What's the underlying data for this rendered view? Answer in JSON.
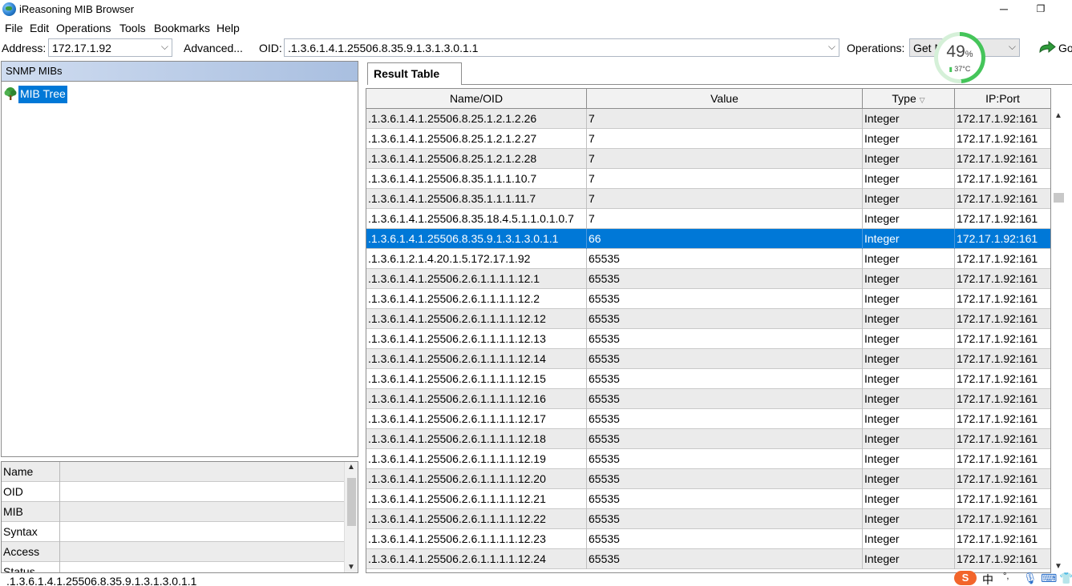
{
  "window": {
    "title": "iReasoning MIB Browser",
    "minimize_glyph": "─",
    "maximize_glyph": "❐"
  },
  "menu": [
    "File",
    "Edit",
    "Operations",
    "Tools",
    "Bookmarks",
    "Help"
  ],
  "toolbar": {
    "address_label": "Address:",
    "address_value": "172.17.1.92",
    "advanced_label": "Advanced...",
    "oid_label": "OID:",
    "oid_value": ".1.3.6.1.4.1.25506.8.35.9.1.3.1.3.0.1.1",
    "operations_label": "Operations:",
    "operations_value": "Get N",
    "go_label": "Go",
    "go_icon": "go-arrow-icon"
  },
  "cpu_widget": {
    "percent": "49",
    "percent_sign": "%",
    "temperature": "37°C",
    "load_fraction": 0.49,
    "ring_color": "#45c55a"
  },
  "mib_panel": {
    "header": "SNMP MIBs",
    "tree_root": "MIB Tree",
    "tree_icon": "tree-icon"
  },
  "properties": {
    "rows": [
      "Name",
      "OID",
      "MIB",
      "Syntax",
      "Access",
      "Status"
    ]
  },
  "result": {
    "tab_label": "Result Table",
    "columns": [
      "Name/OID",
      "Value",
      "Type",
      "IP:Port"
    ],
    "sort_indicator": "▽",
    "selected_row_index": 6,
    "rows": [
      [
        ".1.3.6.1.4.1.25506.8.25.1.2.1.2.26",
        "7",
        "Integer",
        "172.17.1.92:161"
      ],
      [
        ".1.3.6.1.4.1.25506.8.25.1.2.1.2.27",
        "7",
        "Integer",
        "172.17.1.92:161"
      ],
      [
        ".1.3.6.1.4.1.25506.8.25.1.2.1.2.28",
        "7",
        "Integer",
        "172.17.1.92:161"
      ],
      [
        ".1.3.6.1.4.1.25506.8.35.1.1.1.10.7",
        "7",
        "Integer",
        "172.17.1.92:161"
      ],
      [
        ".1.3.6.1.4.1.25506.8.35.1.1.1.11.7",
        "7",
        "Integer",
        "172.17.1.92:161"
      ],
      [
        ".1.3.6.1.4.1.25506.8.35.18.4.5.1.1.0.1.0.7",
        "7",
        "Integer",
        "172.17.1.92:161"
      ],
      [
        ".1.3.6.1.4.1.25506.8.35.9.1.3.1.3.0.1.1",
        "66",
        "Integer",
        "172.17.1.92:161"
      ],
      [
        ".1.3.6.1.2.1.4.20.1.5.172.17.1.92",
        "65535",
        "Integer",
        "172.17.1.92:161"
      ],
      [
        ".1.3.6.1.4.1.25506.2.6.1.1.1.1.12.1",
        "65535",
        "Integer",
        "172.17.1.92:161"
      ],
      [
        ".1.3.6.1.4.1.25506.2.6.1.1.1.1.12.2",
        "65535",
        "Integer",
        "172.17.1.92:161"
      ],
      [
        ".1.3.6.1.4.1.25506.2.6.1.1.1.1.12.12",
        "65535",
        "Integer",
        "172.17.1.92:161"
      ],
      [
        ".1.3.6.1.4.1.25506.2.6.1.1.1.1.12.13",
        "65535",
        "Integer",
        "172.17.1.92:161"
      ],
      [
        ".1.3.6.1.4.1.25506.2.6.1.1.1.1.12.14",
        "65535",
        "Integer",
        "172.17.1.92:161"
      ],
      [
        ".1.3.6.1.4.1.25506.2.6.1.1.1.1.12.15",
        "65535",
        "Integer",
        "172.17.1.92:161"
      ],
      [
        ".1.3.6.1.4.1.25506.2.6.1.1.1.1.12.16",
        "65535",
        "Integer",
        "172.17.1.92:161"
      ],
      [
        ".1.3.6.1.4.1.25506.2.6.1.1.1.1.12.17",
        "65535",
        "Integer",
        "172.17.1.92:161"
      ],
      [
        ".1.3.6.1.4.1.25506.2.6.1.1.1.1.12.18",
        "65535",
        "Integer",
        "172.17.1.92:161"
      ],
      [
        ".1.3.6.1.4.1.25506.2.6.1.1.1.1.12.19",
        "65535",
        "Integer",
        "172.17.1.92:161"
      ],
      [
        ".1.3.6.1.4.1.25506.2.6.1.1.1.1.12.20",
        "65535",
        "Integer",
        "172.17.1.92:161"
      ],
      [
        ".1.3.6.1.4.1.25506.2.6.1.1.1.1.12.21",
        "65535",
        "Integer",
        "172.17.1.92:161"
      ],
      [
        ".1.3.6.1.4.1.25506.2.6.1.1.1.1.12.22",
        "65535",
        "Integer",
        "172.17.1.92:161"
      ],
      [
        ".1.3.6.1.4.1.25506.2.6.1.1.1.1.12.23",
        "65535",
        "Integer",
        "172.17.1.92:161"
      ],
      [
        ".1.3.6.1.4.1.25506.2.6.1.1.1.1.12.24",
        "65535",
        "Integer",
        "172.17.1.92:161"
      ]
    ]
  },
  "status_bar": {
    "text": ".1.3.6.1.4.1.25506.8.35.9.1.3.1.3.0.1.1"
  },
  "ime_tray": {
    "logo": "S",
    "lang": "中",
    "punct": "°,",
    "mic_icon": "microphone-icon",
    "keyboard_icon": "keyboard-icon",
    "settings_icon": "shirt-icon"
  },
  "colors": {
    "selection": "#0078d7",
    "header_gradient_start": "#cfdcf0",
    "header_gradient_end": "#a9bfe0",
    "ime_logo": "#f2652b"
  }
}
